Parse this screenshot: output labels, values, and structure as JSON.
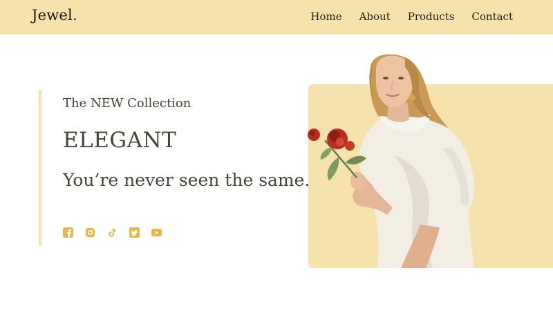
{
  "brand": {
    "logo": "Jewel."
  },
  "nav": {
    "items": [
      {
        "label": "Home"
      },
      {
        "label": "About"
      },
      {
        "label": "Products"
      },
      {
        "label": "Contact"
      }
    ]
  },
  "hero": {
    "subtitle": "The NEW Collection",
    "headline": "ELEGANT",
    "tagline": "You’re never seen the same."
  },
  "socials": [
    {
      "icon": "facebook-icon"
    },
    {
      "icon": "instagram-icon"
    },
    {
      "icon": "tiktok-icon"
    },
    {
      "icon": "twitter-icon"
    },
    {
      "icon": "youtube-icon"
    }
  ],
  "colors": {
    "accent": "#f5e2ad",
    "icon": "#e5b84a",
    "text": "#4a4235",
    "nav_text": "#1f1a12"
  }
}
